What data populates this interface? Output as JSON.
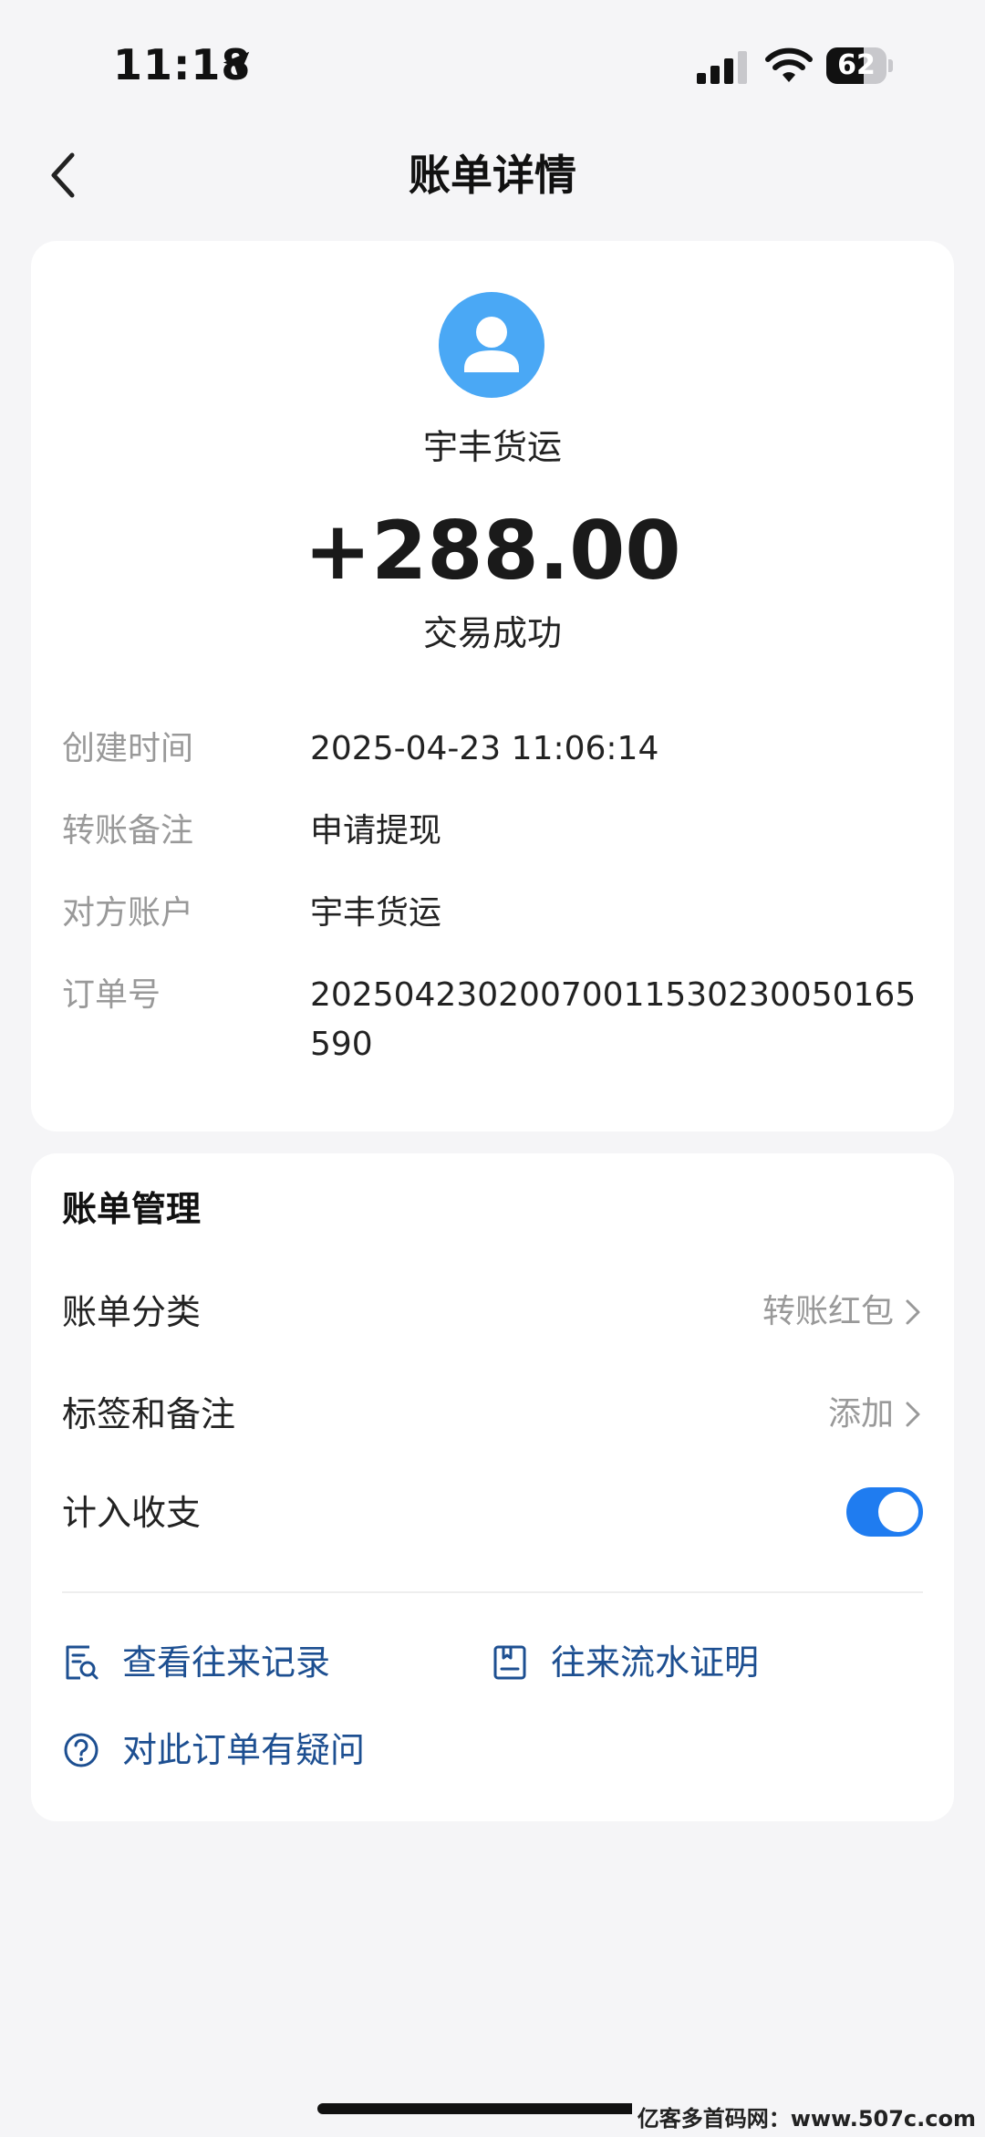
{
  "status_bar": {
    "time": "11:18",
    "battery": "62",
    "battery_level": 0.62
  },
  "nav": {
    "title": "账单详情"
  },
  "summary": {
    "payee": "宇丰货运",
    "amount": "+288.00",
    "status": "交易成功"
  },
  "details": [
    {
      "label": "创建时间",
      "value": "2025-04-23 11:06:14"
    },
    {
      "label": "转账备注",
      "value": "申请提现"
    },
    {
      "label": "对方账户",
      "value": "宇丰货运"
    },
    {
      "label": "订单号",
      "value": "20250423020070011530230050165590"
    }
  ],
  "management": {
    "title": "账单管理",
    "category_label": "账单分类",
    "category_value": "转账红包",
    "tags_label": "标签和备注",
    "tags_value": "添加",
    "include_label": "计入收支",
    "include_on": true
  },
  "links": {
    "records": "查看往来记录",
    "proof": "往来流水证明",
    "question": "对此订单有疑问"
  },
  "colors": {
    "accent": "#1f7cf0",
    "link": "#1d4f91",
    "avatar": "#4aa8f5"
  },
  "watermark": "亿客多首码网：www.507c.com"
}
